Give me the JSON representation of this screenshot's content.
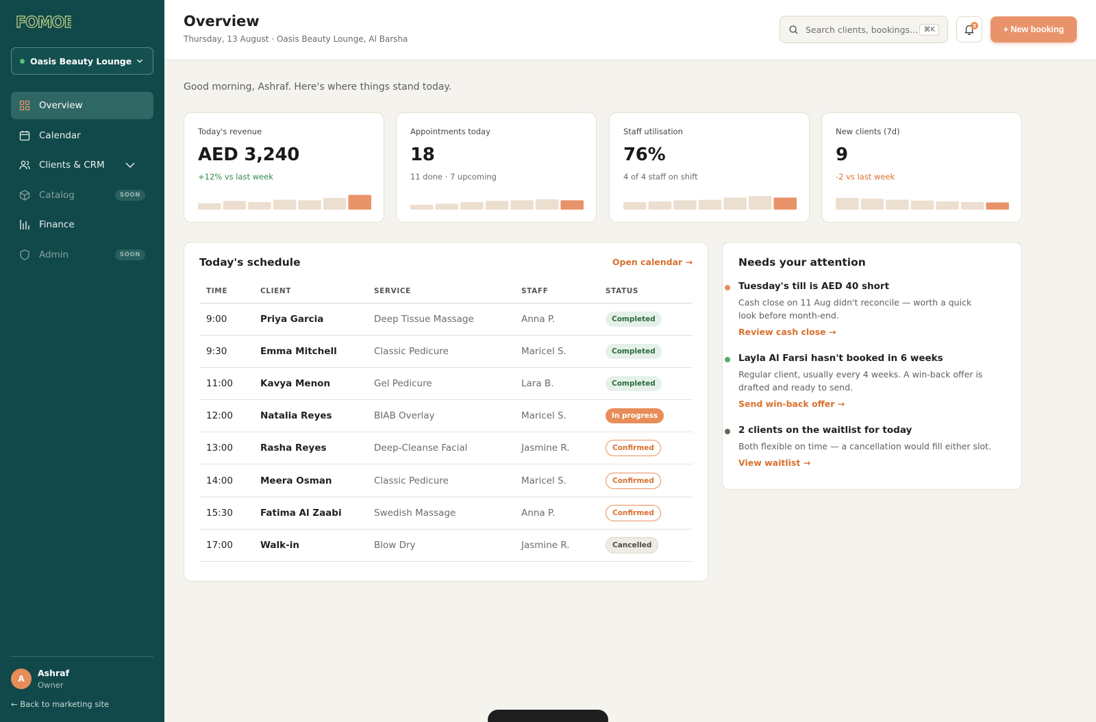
{
  "brand": {
    "logo_text": "FOMOE",
    "accent": "#e9936a",
    "sidebar_bg": "#11484a"
  },
  "sidebar": {
    "venue": "Oasis Beauty Lounge",
    "items": [
      {
        "label": "Overview",
        "icon": "grid-icon",
        "active": true
      },
      {
        "label": "Calendar",
        "icon": "calendar-icon"
      },
      {
        "label": "Clients & CRM",
        "icon": "users-icon"
      },
      {
        "label": "Catalog",
        "icon": "box-icon",
        "badge": "SOON"
      },
      {
        "label": "Finance",
        "icon": "bar-chart-icon"
      },
      {
        "label": "Admin",
        "icon": "shield-icon",
        "badge": "SOON"
      }
    ],
    "user": {
      "initial": "A",
      "name": "Ashraf",
      "role": "Owner"
    },
    "back_link": "← Back to marketing site"
  },
  "header": {
    "title": "Overview",
    "subtitle": "Thursday, 13 August · Oasis Beauty Lounge, Al Barsha",
    "search_placeholder": "Search clients, bookings...",
    "search_shortcut": "⌘K",
    "notification_count": "3",
    "new_booking_label": "+ New booking"
  },
  "greeting": "Good morning, Ashraf. Here's where things stand today.",
  "kpis": [
    {
      "label": "Today's revenue",
      "value": "AED 3,240",
      "delta": "+12% vs last week",
      "delta_type": "up",
      "bars": [
        0.42,
        0.58,
        0.5,
        0.66,
        0.62,
        0.78,
        0.98
      ]
    },
    {
      "label": "Appointments today",
      "value": "18",
      "delta": "11 done · 7 upcoming",
      "delta_type": "neutral",
      "bars": [
        0.32,
        0.4,
        0.5,
        0.58,
        0.62,
        0.68,
        0.62
      ]
    },
    {
      "label": "Staff utilisation",
      "value": "76%",
      "delta": "4 of 4 staff on shift",
      "delta_type": "neutral",
      "bars": [
        0.5,
        0.55,
        0.62,
        0.65,
        0.8,
        0.9,
        0.8
      ]
    },
    {
      "label": "New clients (7d)",
      "value": "9",
      "delta": "-2 vs last week",
      "delta_type": "down",
      "bars": [
        0.78,
        0.72,
        0.66,
        0.6,
        0.55,
        0.5,
        0.48
      ]
    }
  ],
  "schedule": {
    "title": "Today's schedule",
    "link": "Open calendar →",
    "columns": [
      "TIME",
      "CLIENT",
      "SERVICE",
      "STAFF",
      "STATUS"
    ],
    "rows": [
      {
        "time": "9:00",
        "client": "Priya Garcia",
        "service": "Deep Tissue Massage",
        "staff": "Anna P.",
        "status": "Completed",
        "kind": "completed"
      },
      {
        "time": "9:30",
        "client": "Emma Mitchell",
        "service": "Classic Pedicure",
        "staff": "Maricel S.",
        "status": "Completed",
        "kind": "completed"
      },
      {
        "time": "11:00",
        "client": "Kavya Menon",
        "service": "Gel Pedicure",
        "staff": "Lara B.",
        "status": "Completed",
        "kind": "completed"
      },
      {
        "time": "12:00",
        "client": "Natalia Reyes",
        "service": "BIAB Overlay",
        "staff": "Maricel S.",
        "status": "In progress",
        "kind": "progress"
      },
      {
        "time": "13:00",
        "client": "Rasha Reyes",
        "service": "Deep-Cleanse Facial",
        "staff": "Jasmine R.",
        "status": "Confirmed",
        "kind": "confirmed"
      },
      {
        "time": "14:00",
        "client": "Meera Osman",
        "service": "Classic Pedicure",
        "staff": "Maricel S.",
        "status": "Confirmed",
        "kind": "confirmed"
      },
      {
        "time": "15:30",
        "client": "Fatima Al Zaabi",
        "service": "Swedish Massage",
        "staff": "Anna P.",
        "status": "Confirmed",
        "kind": "confirmed"
      },
      {
        "time": "17:00",
        "client": "Walk-in",
        "service": "Blow Dry",
        "staff": "Jasmine R.",
        "status": "Cancelled",
        "kind": "cancelled"
      }
    ]
  },
  "attention": {
    "title": "Needs your attention",
    "items": [
      {
        "title": "Tuesday's till is AED 40 short",
        "body": "Cash close on 11 Aug didn't reconcile — worth a quick look before month-end.",
        "link": "Review cash close →",
        "dot": "#e88d5a"
      },
      {
        "title": "Layla Al Farsi hasn't booked in 6 weeks",
        "body": "Regular client, usually every 4 weeks. A win-back offer is drafted and ready to send.",
        "link": "Send win-back offer →",
        "dot": "#4fae6a"
      },
      {
        "title": "2 clients on the waitlist for today",
        "body": "Both flexible on time — a cancellation would fill either slot.",
        "link": "View waitlist →",
        "dot": "#6a645c"
      }
    ]
  }
}
